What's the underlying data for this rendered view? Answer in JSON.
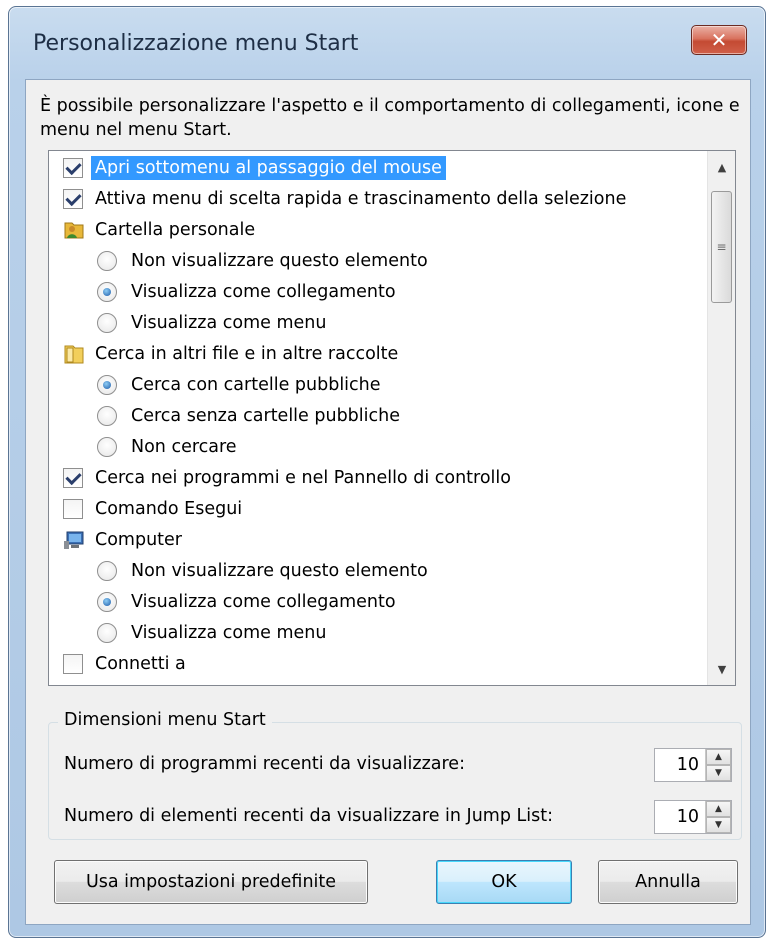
{
  "window": {
    "title": "Personalizzazione menu Start",
    "close_label": "✕"
  },
  "description": "È possibile personalizzare l'aspetto e il comportamento di collegamenti, icone e menu nel menu Start.",
  "options": [
    {
      "type": "checkbox",
      "checked": true,
      "label": "Apri sottomenu al passaggio del mouse",
      "selected": true
    },
    {
      "type": "checkbox",
      "checked": true,
      "label": "Attiva menu di scelta rapida e trascinamento della selezione"
    },
    {
      "type": "folder",
      "icon": "user-folder-icon",
      "label": "Cartella personale"
    },
    {
      "type": "radio",
      "on": false,
      "label": "Non visualizzare questo elemento"
    },
    {
      "type": "radio",
      "on": true,
      "label": "Visualizza come collegamento"
    },
    {
      "type": "radio",
      "on": false,
      "label": "Visualizza come menu"
    },
    {
      "type": "folder",
      "icon": "search-folder-icon",
      "label": "Cerca in altri file e in altre raccolte"
    },
    {
      "type": "radio",
      "on": true,
      "label": "Cerca con cartelle pubbliche"
    },
    {
      "type": "radio",
      "on": false,
      "label": "Cerca senza cartelle pubbliche"
    },
    {
      "type": "radio",
      "on": false,
      "label": "Non cercare"
    },
    {
      "type": "checkbox",
      "checked": true,
      "label": "Cerca nei programmi e nel Pannello di controllo"
    },
    {
      "type": "checkbox",
      "checked": false,
      "label": "Comando Esegui"
    },
    {
      "type": "folder",
      "icon": "computer-icon",
      "label": "Computer"
    },
    {
      "type": "radio",
      "on": false,
      "label": "Non visualizzare questo elemento"
    },
    {
      "type": "radio",
      "on": true,
      "label": "Visualizza come collegamento"
    },
    {
      "type": "radio",
      "on": false,
      "label": "Visualizza come menu"
    },
    {
      "type": "checkbox",
      "checked": false,
      "label": "Connetti a"
    }
  ],
  "sizes": {
    "group_title": "Dimensioni menu Start",
    "recent_programs_label": "Numero di programmi recenti da visualizzare:",
    "recent_programs_value": "10",
    "jump_list_label": "Numero di elementi recenti da visualizzare in Jump List:",
    "jump_list_value": "10"
  },
  "buttons": {
    "defaults": "Usa impostazioni predefinite",
    "ok": "OK",
    "cancel": "Annulla"
  },
  "colors": {
    "selection": "#3399ff",
    "title_text": "#1e2e45",
    "close_red": "#c44a33"
  }
}
